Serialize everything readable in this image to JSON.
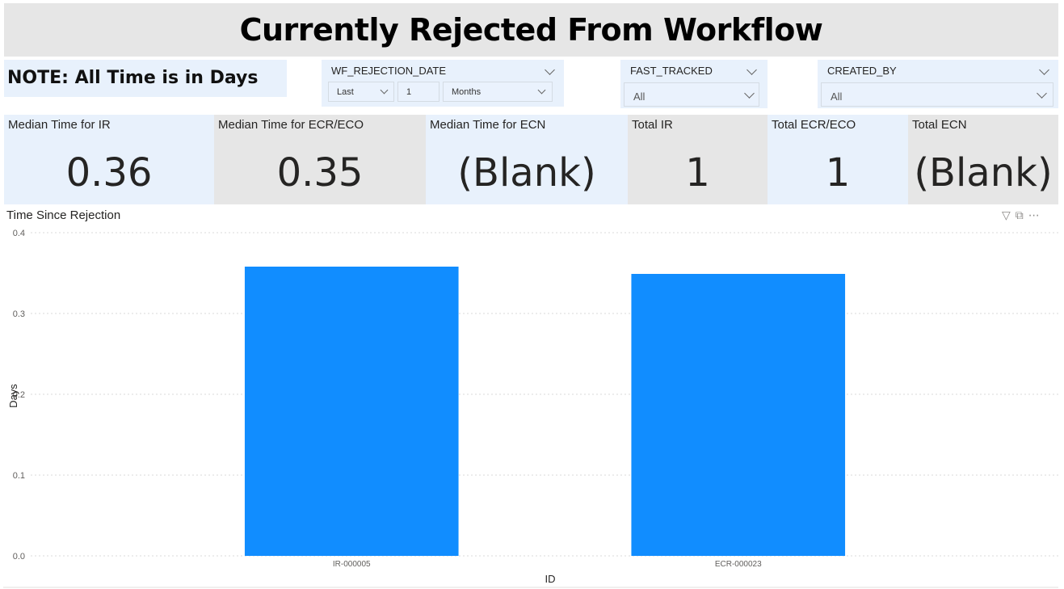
{
  "title": "Currently Rejected From Workflow",
  "note": "NOTE: All Time is in Days",
  "slicers": {
    "wf_rejection_date": {
      "label": "WF_REJECTION_DATE",
      "period": "Last",
      "count": "1",
      "unit": "Months"
    },
    "fast_tracked": {
      "label": "FAST_TRACKED",
      "value": "All"
    },
    "created_by": {
      "label": "CREATED_BY",
      "value": "All"
    }
  },
  "cards": [
    {
      "label": "Median Time for IR",
      "value": "0.36"
    },
    {
      "label": "Median Time for ECR/ECO",
      "value": "0.35"
    },
    {
      "label": "Median Time for ECN",
      "value": "(Blank)"
    },
    {
      "label": "Total IR",
      "value": "1"
    },
    {
      "label": "Total ECR/ECO",
      "value": "1"
    },
    {
      "label": "Total ECN",
      "value": "(Blank)"
    }
  ],
  "chart_header": {
    "title": "Time Since Rejection",
    "icons": [
      "filter-icon",
      "focus-mode-icon",
      "more-options-icon"
    ]
  },
  "chart_data": {
    "type": "bar",
    "categories": [
      "IR-000005",
      "ECR-000023"
    ],
    "values": [
      0.358,
      0.349
    ],
    "xlabel": "ID",
    "ylabel": "Days",
    "ylim": [
      0,
      0.4
    ],
    "yticks": [
      "0.0",
      "0.1",
      "0.2",
      "0.3",
      "0.4"
    ],
    "grid": true,
    "bar_color": "#118dff"
  },
  "colors": {
    "card_blue": "#e8f1fc",
    "card_grey": "#e6e6e6",
    "bar": "#118dff"
  }
}
